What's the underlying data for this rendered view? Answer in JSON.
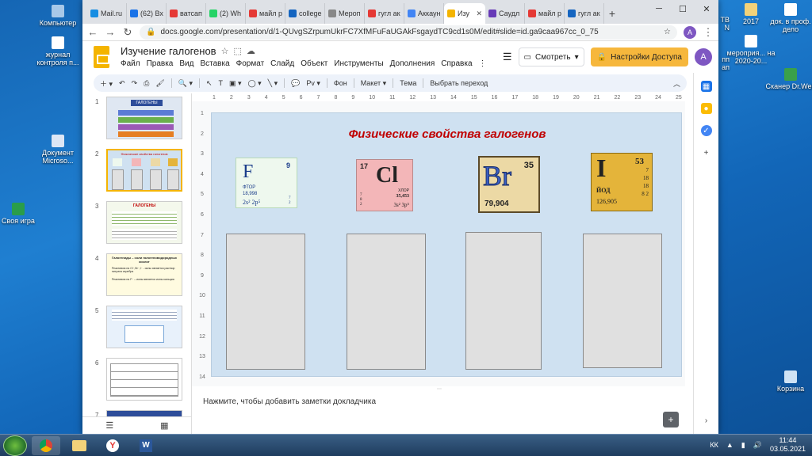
{
  "desktop_left": [
    "Компьютер",
    "журнал контроля п...",
    "Документ Microso...",
    "Своя игра"
  ],
  "desktop_right": [
    "2017",
    "док. в проф. дело",
    "мероприя... на 2020-20...",
    "Сканер Dr.Web",
    "Корзина"
  ],
  "desktop_right_partial": [
    "ТВ",
    "N",
    "пп",
    "ап"
  ],
  "browser": {
    "tabs": [
      "Mail.ru",
      "(62) Вх",
      "ватсап",
      "(2) Wh",
      "майл р",
      "college",
      "Мероп",
      "гугл ак",
      "Аккаун",
      "Изу",
      "Саудл",
      "майл р",
      "гугл ак"
    ],
    "active_tab_index": 8,
    "url": "docs.google.com/presentation/d/1-QUvgSZrpumUkrFC7XfMFuFaUGAkFsgaydTC9cd1s0M/edit#slide=id.ga9caa967cc_0_75",
    "avatar": "A"
  },
  "doc": {
    "title": "Изучение галогенов",
    "menu": [
      "Файл",
      "Правка",
      "Вид",
      "Вставка",
      "Формат",
      "Слайд",
      "Объект",
      "Инструменты",
      "Дополнения",
      "Справка"
    ],
    "view_label": "Смотреть",
    "share_label": "Настройки Доступа",
    "avatar": "A"
  },
  "toolbar": {
    "bg": "Фон",
    "layout": "Макет",
    "theme": "Тема",
    "transition": "Выбрать переход"
  },
  "thumbs": {
    "nums": [
      "1",
      "2",
      "3",
      "4",
      "5",
      "6",
      "7"
    ],
    "t1_title": "ГАЛОГЕНЫ",
    "t2_title": "Физические свойства галогенов",
    "t3_title": "ГАЛОГЕНЫ",
    "t4_title": "Галогениды – соли галогеноводородных кислот",
    "t4_line1": "Реактивом на Cl⁻,Br⁻,I⁻ - ионы является раствор нитрата серебра",
    "t4_line2": "Реактивом на F⁻ – ионы является ионы кальция"
  },
  "ruler": {
    "top": [
      "1",
      "2",
      "3",
      "4",
      "5",
      "6",
      "7",
      "8",
      "9",
      "10",
      "11",
      "12",
      "13",
      "14",
      "15",
      "16",
      "17",
      "18",
      "19",
      "20",
      "21",
      "22",
      "23",
      "24",
      "25"
    ],
    "left": [
      "1",
      "2",
      "3",
      "4",
      "5",
      "6",
      "7",
      "8",
      "9",
      "10",
      "11",
      "12",
      "13",
      "14"
    ]
  },
  "slide": {
    "title": "Физические свойства галогенов",
    "f": {
      "symbol": "F",
      "number": "9",
      "name": "ФТОР",
      "mass": "18,998",
      "config": "2s² 2p⁵",
      "shells": "7 2"
    },
    "cl": {
      "symbol": "Cl",
      "number": "17",
      "name": "ХЛОР",
      "mass": "35,453",
      "config": "3s² 3p⁵",
      "shells": "7 8 2"
    },
    "br": {
      "symbol": "Br",
      "number": "35",
      "mass": "79,904"
    },
    "i": {
      "symbol": "I",
      "number": "53",
      "name": "ЙОД",
      "mass": "126,905",
      "shells": "7 18 18 8 2"
    }
  },
  "notes": "Нажмите, чтобы добавить заметки докладчика",
  "taskbar": {
    "lang": "КК",
    "time": "11:44",
    "date": "03.05.2021"
  }
}
